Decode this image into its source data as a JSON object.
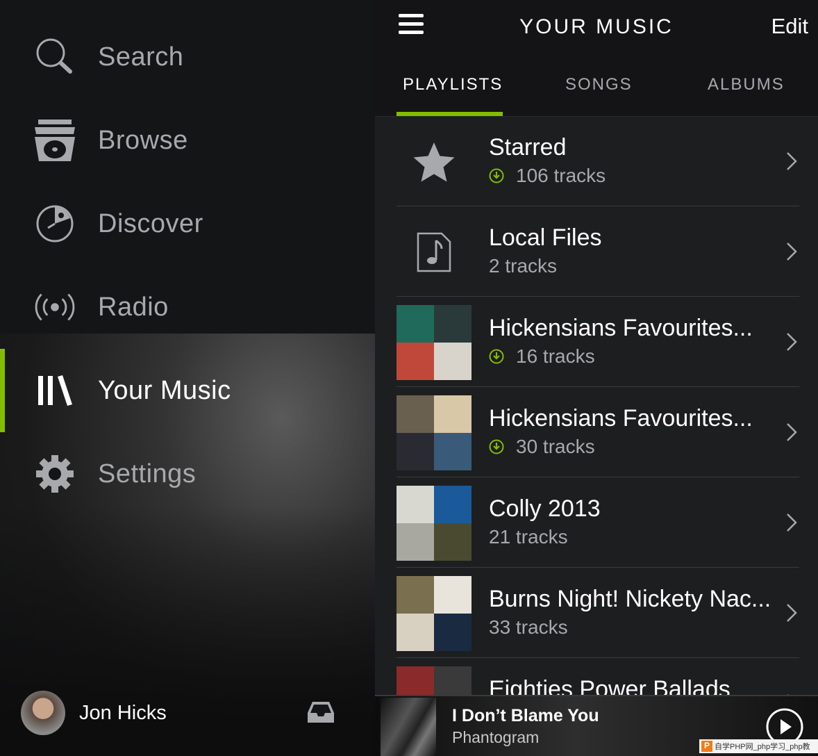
{
  "sidebar": {
    "items": [
      {
        "label": "Search",
        "icon": "search-icon"
      },
      {
        "label": "Browse",
        "icon": "browse-icon"
      },
      {
        "label": "Discover",
        "icon": "discover-icon"
      },
      {
        "label": "Radio",
        "icon": "radio-icon"
      },
      {
        "label": "Your Music",
        "icon": "your-music-icon",
        "active": true
      },
      {
        "label": "Settings",
        "icon": "gear-icon"
      }
    ],
    "user": {
      "name": "Jon Hicks"
    }
  },
  "header": {
    "title": "YOUR MUSIC",
    "edit_label": "Edit"
  },
  "tabs": [
    {
      "label": "PLAYLISTS",
      "active": true
    },
    {
      "label": "SONGS"
    },
    {
      "label": "ALBUMS"
    }
  ],
  "playlists": [
    {
      "title": "Starred",
      "subtitle": "106 tracks",
      "downloaded": true
    },
    {
      "title": "Local Files",
      "subtitle": "2 tracks",
      "downloaded": false
    },
    {
      "title": "Hickensians Favourites...",
      "subtitle": "16 tracks",
      "downloaded": true
    },
    {
      "title": "Hickensians Favourites...",
      "subtitle": "30 tracks",
      "downloaded": true
    },
    {
      "title": "Colly 2013",
      "subtitle": "21 tracks",
      "downloaded": false
    },
    {
      "title": "Burns Night! Nickety Nac...",
      "subtitle": "33 tracks",
      "downloaded": false
    },
    {
      "title": "Eighties Power Ballads",
      "subtitle": "",
      "downloaded": false
    }
  ],
  "now_playing": {
    "title": "I Don’t Blame You",
    "artist": "Phantogram"
  },
  "watermark": "自学PHP网_php学习_php教",
  "colors": {
    "accent": "#84bd00",
    "sidebar_bg": "#141517",
    "list_bg": "#1d1e20"
  }
}
